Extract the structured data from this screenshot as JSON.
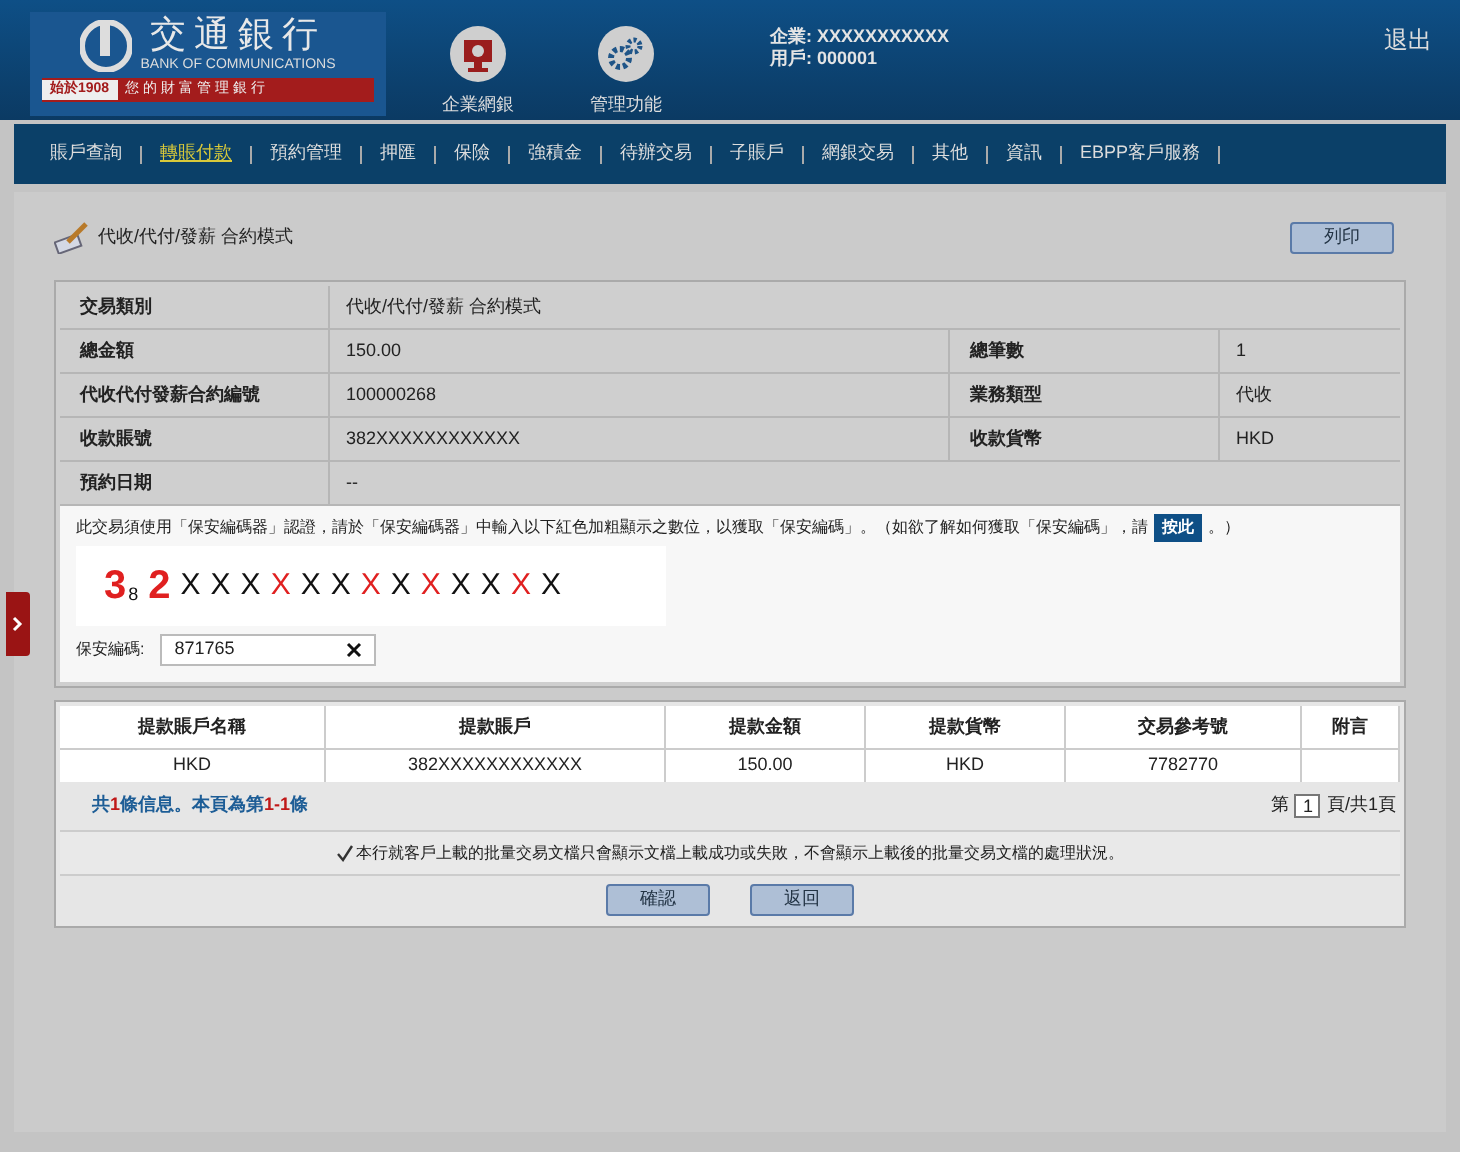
{
  "header": {
    "logo_name": "交通銀行",
    "logo_english": "BANK OF COMMUNICATIONS",
    "logo_since": "始於1908",
    "logo_slogan": "您的財富管理銀行",
    "apps": [
      {
        "label": "企業網銀",
        "kind": "bank"
      },
      {
        "label": "管理功能",
        "kind": "gears"
      }
    ],
    "company": "企業: XXXXXXXXXXX",
    "user": "用戶: 000001",
    "logout": "退出"
  },
  "nav": [
    {
      "label": "賬戶查詢",
      "selected": false
    },
    {
      "label": "轉賬付款",
      "selected": true
    },
    {
      "label": "預約管理",
      "selected": false
    },
    {
      "label": "押匯",
      "selected": false
    },
    {
      "label": "保險",
      "selected": false
    },
    {
      "label": "強積金",
      "selected": false
    },
    {
      "label": "待辦交易",
      "selected": false
    },
    {
      "label": "子賬戶",
      "selected": false
    },
    {
      "label": "網銀交易",
      "selected": false
    },
    {
      "label": "其他",
      "selected": false
    },
    {
      "label": "資訊",
      "selected": false
    },
    {
      "label": "EBPP客戶服務",
      "selected": false
    }
  ],
  "page": {
    "title": "代收/代付/發薪 合約模式",
    "print_button": "列印"
  },
  "details": [
    [
      {
        "label": "交易類別",
        "value": "代收/代付/發薪 合約模式"
      }
    ],
    [
      {
        "label": "總金額",
        "value": "150.00"
      },
      {
        "label": "總筆數",
        "value": "1"
      }
    ],
    [
      {
        "label": "代收代付發薪合約編號",
        "value": "100000268"
      },
      {
        "label": "業務類型",
        "value": "代收"
      }
    ],
    [
      {
        "label": "收款賬號",
        "value": "382XXXXXXXXXXXX"
      },
      {
        "label": "收款貨幣",
        "value": "HKD"
      }
    ],
    [
      {
        "label": "預約日期",
        "value": "--"
      }
    ]
  ],
  "security": {
    "instruction": "此交易須使用「保安編碼器」認證，請於「保安編碼器」中輸入以下紅色加粗顯示之數位，以獲取「保安編碼」。（如欲了解如何獲取「保安編碼」，請",
    "link": "按此",
    "instruction_end": "。）",
    "code": [
      {
        "char": "3",
        "kind": "big",
        "highlighted": true
      },
      {
        "char": "8",
        "kind": "small",
        "highlighted": false
      },
      {
        "char": "2",
        "kind": "big",
        "highlighted": true
      },
      {
        "char": "X",
        "kind": "mask",
        "highlighted": false
      },
      {
        "char": "X",
        "kind": "mask",
        "highlighted": false
      },
      {
        "char": "X",
        "kind": "mask",
        "highlighted": false
      },
      {
        "char": "X",
        "kind": "mask",
        "highlighted": true
      },
      {
        "char": "X",
        "kind": "mask",
        "highlighted": false
      },
      {
        "char": "X",
        "kind": "mask",
        "highlighted": false
      },
      {
        "char": "X",
        "kind": "mask",
        "highlighted": true
      },
      {
        "char": "X",
        "kind": "mask",
        "highlighted": false
      },
      {
        "char": "X",
        "kind": "mask",
        "highlighted": true
      },
      {
        "char": "X",
        "kind": "mask",
        "highlighted": false
      },
      {
        "char": "X",
        "kind": "mask",
        "highlighted": false
      },
      {
        "char": "X",
        "kind": "mask",
        "highlighted": true
      },
      {
        "char": "X",
        "kind": "mask",
        "highlighted": false
      }
    ],
    "field_label": "保安編碼:",
    "field_value": "871765"
  },
  "table": {
    "columns": [
      "提款賬戶名稱",
      "提款賬戶",
      "提款金額",
      "提款貨幣",
      "交易參考號",
      "附言"
    ],
    "rows": [
      [
        "HKD",
        "382XXXXXXXXXXXX",
        "150.00",
        "HKD",
        "7782770",
        ""
      ]
    ]
  },
  "summary": "共**1**條信息。本頁為第**1-1**條",
  "pager": {
    "prefix": "第",
    "page": "1",
    "suffix": "頁/共1頁"
  },
  "notice": {
    "checked": true,
    "text": "本行就客戶上載的批量交易文檔只會顯示文檔上載成功或失敗，不會顯示上載後的批量交易文檔的處理狀況。"
  },
  "buttons": [
    "確認",
    "返回"
  ]
}
